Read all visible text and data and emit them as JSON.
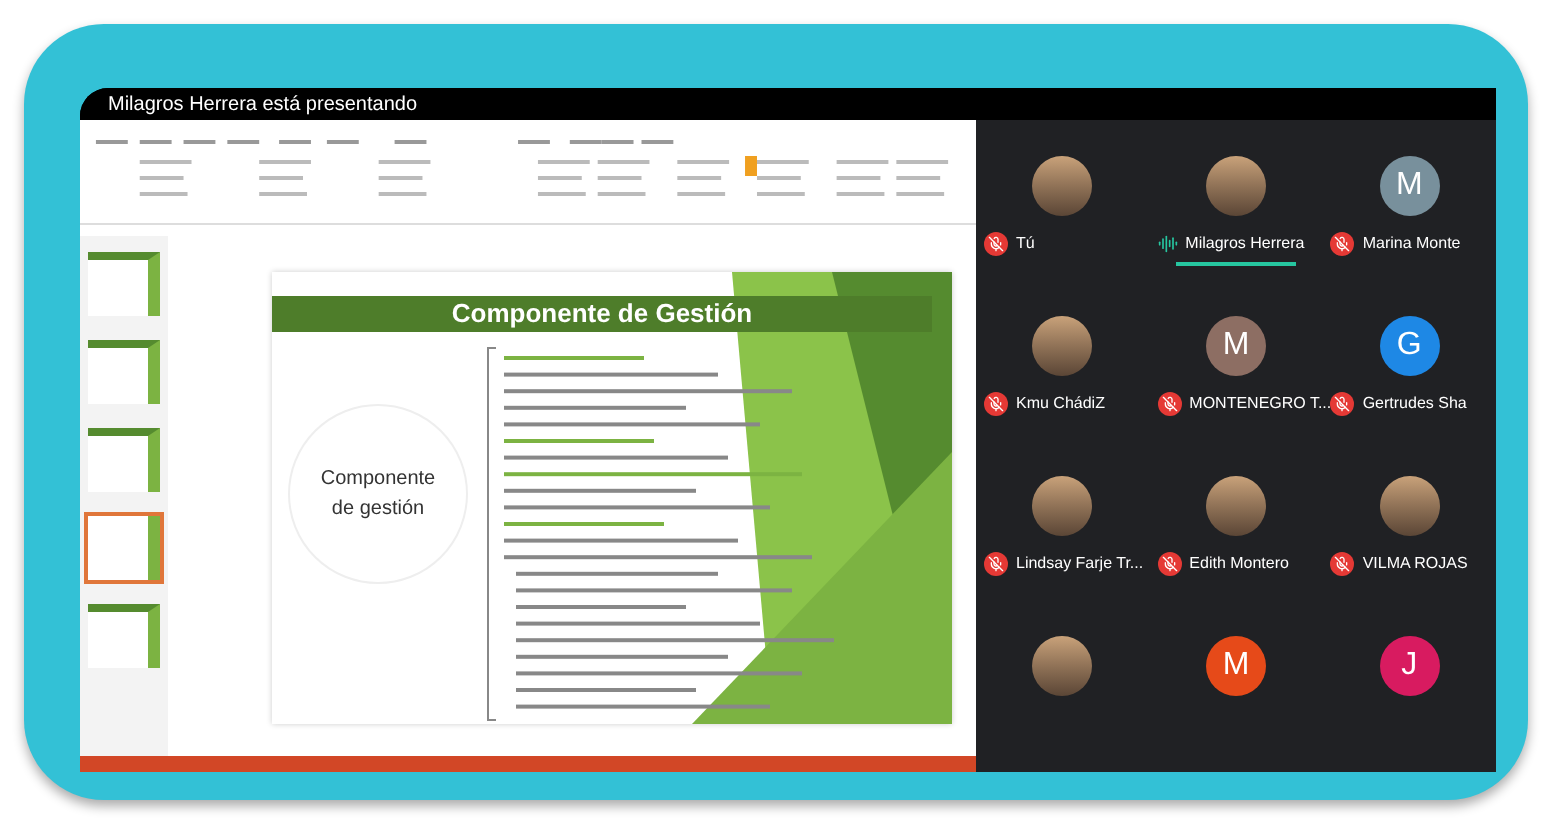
{
  "presenter_banner": "Milagros Herrera está presentando",
  "slide": {
    "title": "Componente de Gestión",
    "side_label": "Componente de gestión"
  },
  "thumbnails": [
    {
      "selected": false
    },
    {
      "selected": false
    },
    {
      "selected": false
    },
    {
      "selected": true
    },
    {
      "selected": false
    }
  ],
  "participants": [
    {
      "name": "Tú",
      "kind": "photo",
      "muted": true,
      "speaking": false
    },
    {
      "name": "Milagros Herrera",
      "kind": "photo",
      "muted": false,
      "speaking": true
    },
    {
      "name": "Marina Monte",
      "kind": "letter",
      "letter": "M",
      "color": "#78909c",
      "muted": true,
      "speaking": false
    },
    {
      "name": "Kmu ChádiZ",
      "kind": "photo",
      "muted": true,
      "speaking": false
    },
    {
      "name": "MONTENEGRO T...",
      "kind": "letter",
      "letter": "M",
      "color": "#8d6e63",
      "muted": true,
      "speaking": false
    },
    {
      "name": "Gertrudes Sha",
      "kind": "letter",
      "letter": "G",
      "color": "#1e88e5",
      "muted": true,
      "speaking": false
    },
    {
      "name": "Lindsay Farje Tr...",
      "kind": "photo",
      "muted": true,
      "speaking": false
    },
    {
      "name": "Edith Montero",
      "kind": "photo",
      "muted": true,
      "speaking": false
    },
    {
      "name": "VILMA ROJAS",
      "kind": "photo",
      "muted": true,
      "speaking": false
    },
    {
      "kind": "photo"
    },
    {
      "kind": "letter",
      "letter": "M",
      "color": "#e64a19"
    },
    {
      "kind": "letter",
      "letter": "J",
      "color": "#d81b60"
    }
  ]
}
